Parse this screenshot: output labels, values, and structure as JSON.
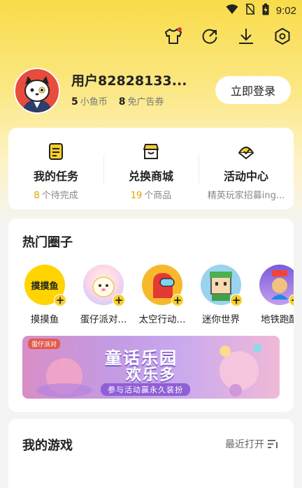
{
  "status_bar": {
    "time": "9:02",
    "icons": [
      "wifi-icon",
      "no-sim-icon",
      "battery-charging-icon"
    ]
  },
  "top_toolbar": {
    "icons": [
      "shirt-icon",
      "refresh-icon",
      "download-icon",
      "settings-icon"
    ]
  },
  "profile": {
    "username": "用户82828133...",
    "coins_count": "5",
    "coins_label": "小鱼币",
    "ad_tickets_count": "8",
    "ad_tickets_label": "免广告券",
    "login_button": "立即登录"
  },
  "quick_actions": [
    {
      "title": "我的任务",
      "count": "8",
      "subtitle": "个待完成",
      "icon": "task-list-icon"
    },
    {
      "title": "兑换商城",
      "count": "19",
      "subtitle": "个商品",
      "icon": "store-icon"
    },
    {
      "title": "活动中心",
      "count": "",
      "subtitle": "精英玩家招募ing...",
      "icon": "activity-flag-icon"
    }
  ],
  "hot_circles": {
    "title": "热门圈子",
    "items": [
      {
        "label": "摸摸鱼",
        "logo_text": "摸摸鱼"
      },
      {
        "label": "蛋仔派对..."
      },
      {
        "label": "太空行动..."
      },
      {
        "label": "迷你世界"
      },
      {
        "label": "地铁跑酷"
      }
    ],
    "banner": {
      "badge": "蛋仔派对",
      "title_line1": "童话乐园",
      "title_line2": "欢乐多",
      "subtitle": "参与活动赢永久装扮"
    }
  },
  "my_games": {
    "title": "我的游戏",
    "sort_label": "最近打开"
  },
  "colors": {
    "accent": "#f9cf2a",
    "highlight_number": "#e6a100"
  }
}
